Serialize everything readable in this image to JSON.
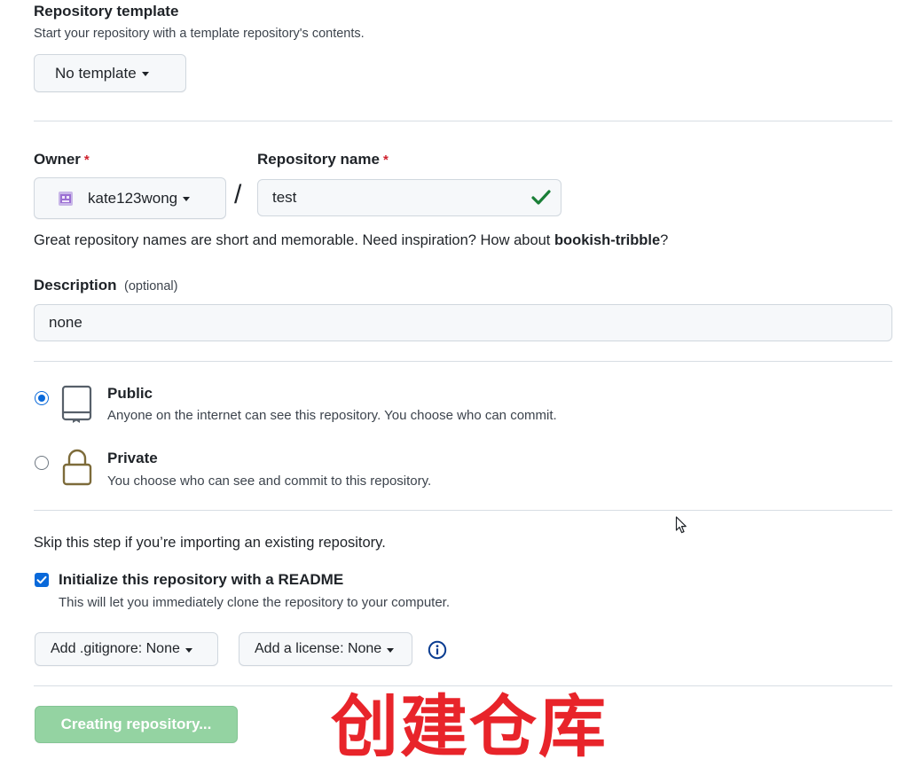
{
  "template_section": {
    "title": "Repository template",
    "subtitle": "Start your repository with a template repository's contents.",
    "select_label": "No template"
  },
  "owner": {
    "label": "Owner",
    "required_mark": "*",
    "value": "kate123wong"
  },
  "separator": "/",
  "repo_name": {
    "label": "Repository name",
    "required_mark": "*",
    "value": "test",
    "valid": true
  },
  "name_hint": {
    "prefix": "Great repository names are short and memorable. Need inspiration? How about ",
    "suggestion": "bookish-tribble",
    "suffix": "?"
  },
  "description": {
    "label": "Description",
    "optional": "(optional)",
    "value": "none"
  },
  "visibility": {
    "selected": "public",
    "options": [
      {
        "title": "Public",
        "desc": "Anyone on the internet can see this repository. You choose who can commit.",
        "icon": "repo-icon"
      },
      {
        "title": "Private",
        "desc": "You choose who can see and commit to this repository.",
        "icon": "lock-icon"
      }
    ]
  },
  "init": {
    "skip_note": "Skip this step if you’re importing an existing repository.",
    "readme_label": "Initialize this repository with a README",
    "readme_desc": "This will let you immediately clone the repository to your computer.",
    "readme_checked": true
  },
  "gitignore_button": "Add .gitignore: None",
  "license_button": "Add a license: None",
  "info_icon": "info-icon",
  "submit_button": "Creating repository...",
  "overlay_caption": "创建仓库",
  "colors": {
    "accent": "#0969da",
    "success": "#1a7f37",
    "submit_disabled": "#94d3a2",
    "caption": "#e8242a"
  }
}
